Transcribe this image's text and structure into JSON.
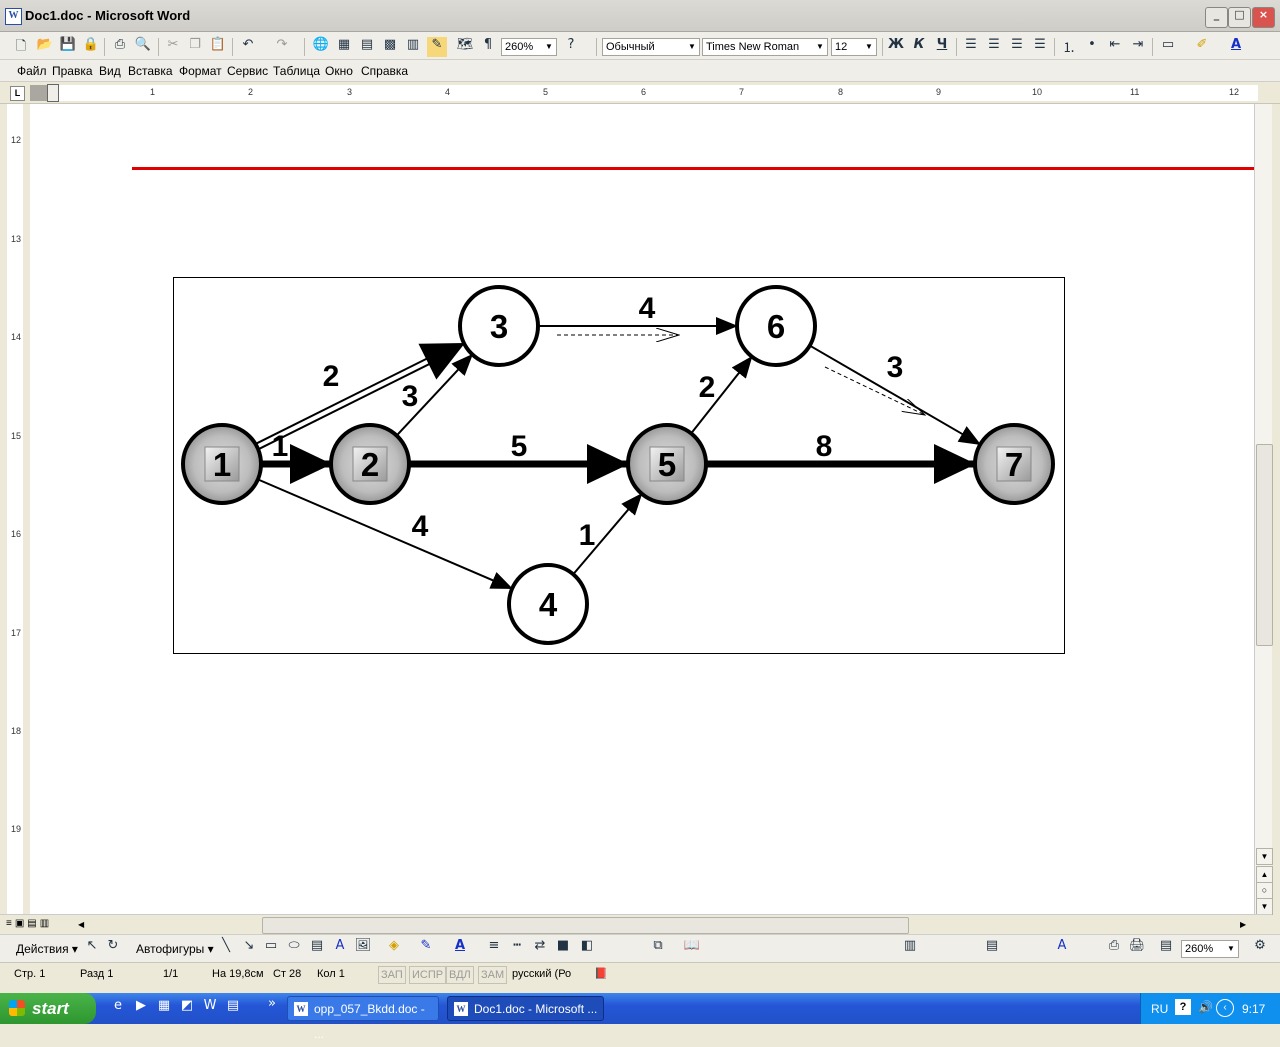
{
  "window": {
    "title": "Doc1.doc - Microsoft Word",
    "buttons": [
      "_",
      "□",
      "×"
    ]
  },
  "standard_toolbar": {
    "zoom": "260%"
  },
  "format_toolbar": {
    "style": "Обычный",
    "font": "Times New Roman",
    "size": "12",
    "bold": "Ж",
    "italic": "К",
    "underline": "Ч"
  },
  "menu": [
    "Файл",
    "Правка",
    "Вид",
    "Вставка",
    "Формат",
    "Сервис",
    "Таблица",
    "Окно",
    "Справка"
  ],
  "hruler_numbers": [
    "1",
    "2",
    "3",
    "4",
    "5",
    "6",
    "7",
    "8",
    "9",
    "10",
    "11",
    "12"
  ],
  "vruler_numbers": [
    "12",
    "13",
    "14",
    "15",
    "16",
    "17",
    "18",
    "19"
  ],
  "diagram": {
    "nodes": [
      {
        "id": "1",
        "critical": true
      },
      {
        "id": "2",
        "critical": true
      },
      {
        "id": "3",
        "critical": false
      },
      {
        "id": "4",
        "critical": false
      },
      {
        "id": "5",
        "critical": true
      },
      {
        "id": "6",
        "critical": false
      },
      {
        "id": "7",
        "critical": true
      }
    ],
    "edges": [
      {
        "from": "1",
        "to": "2",
        "weight": "1",
        "style": "critical"
      },
      {
        "from": "1",
        "to": "3",
        "weight": "2",
        "style": "double"
      },
      {
        "from": "1",
        "to": "4",
        "weight": "4",
        "style": "normal"
      },
      {
        "from": "2",
        "to": "3",
        "weight": "3",
        "style": "normal"
      },
      {
        "from": "2",
        "to": "5",
        "weight": "5",
        "style": "critical"
      },
      {
        "from": "4",
        "to": "5",
        "weight": "1",
        "style": "normal"
      },
      {
        "from": "3",
        "to": "6",
        "weight": "4",
        "style": "normal"
      },
      {
        "from": "5",
        "to": "6",
        "weight": "2",
        "style": "normal"
      },
      {
        "from": "5",
        "to": "7",
        "weight": "8",
        "style": "critical"
      },
      {
        "from": "6",
        "to": "7",
        "weight": "3",
        "style": "normal"
      }
    ]
  },
  "drawing_toolbar": {
    "actions": "Действия",
    "autoshapes": "Автофигуры",
    "zoom": "260%"
  },
  "status": {
    "page": "Стр. 1",
    "section": "Разд 1",
    "pages": "1/1",
    "at": "На 19,8см",
    "line": "Ст 28",
    "col": "Кол 1",
    "rec": "ЗАП",
    "trk": "ИСПР",
    "ext": "ВДЛ",
    "ovr": "ЗАМ",
    "lang": "русский (Ро"
  },
  "taskbar": {
    "start": "start",
    "tasks": [
      "opp_057_Bkdd.doc - ...",
      "Doc1.doc - Microsoft ..."
    ],
    "lang": "RU",
    "time": "9:17"
  },
  "colors": {
    "red_line": "#e00000",
    "critical_node": "#b0b0b0",
    "taskbar": "#2456d6"
  }
}
